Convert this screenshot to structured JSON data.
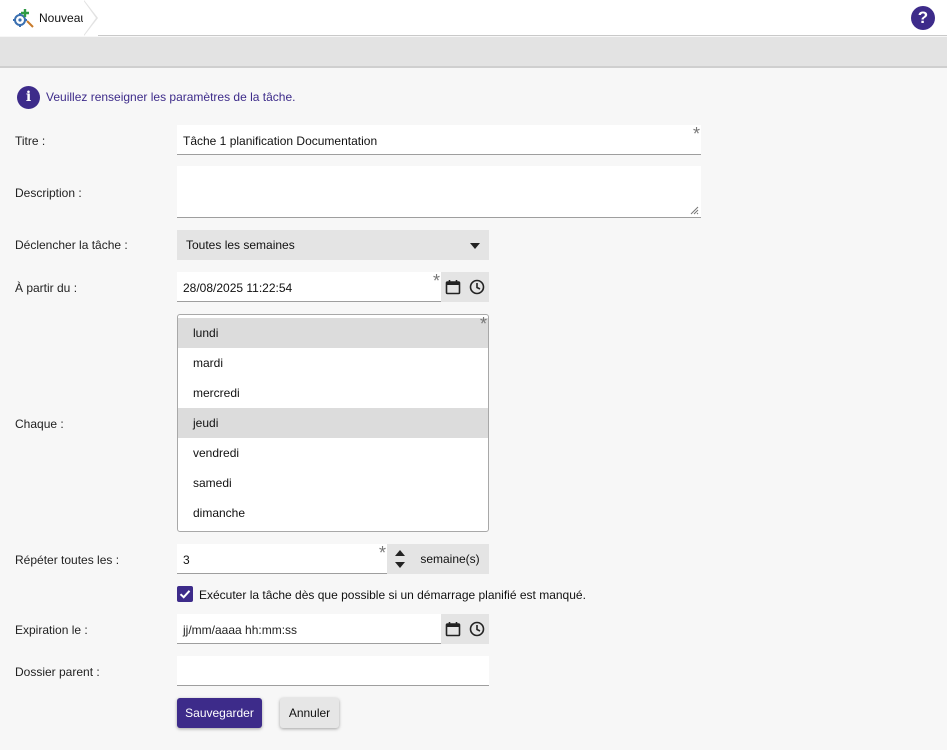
{
  "header": {
    "breadcrumb_label": "Nouveau",
    "breadcrumb_icon": "scheduled-task-icon",
    "help_label": "?",
    "help_icon": "help-circle-icon"
  },
  "info": {
    "icon_label": "i",
    "message": "Veuillez renseigner les paramètres de la tâche."
  },
  "form": {
    "title_label": "Titre :",
    "title_value": "Tâche 1 planification Documentation",
    "description_label": "Description :",
    "description_value": "",
    "trigger_label": "Déclencher la tâche :",
    "trigger_value": "Toutes les semaines",
    "start_label": "À partir du :",
    "start_value": "28/08/2025 11:22:54",
    "every_label": "Chaque :",
    "days": [
      {
        "label": "lundi",
        "selected": true
      },
      {
        "label": "mardi",
        "selected": false
      },
      {
        "label": "mercredi",
        "selected": false
      },
      {
        "label": "jeudi",
        "selected": true
      },
      {
        "label": "vendredi",
        "selected": false
      },
      {
        "label": "samedi",
        "selected": false
      },
      {
        "label": "dimanche",
        "selected": false
      }
    ],
    "repeat_label": "Répéter toutes les :",
    "repeat_value": "3",
    "repeat_unit": "semaine(s)",
    "run_missed_checked": true,
    "run_missed_label": "Exécuter la tâche dès que possible si un démarrage planifié est manqué.",
    "expiration_label": "Expiration le :",
    "expiration_placeholder": "jj/mm/aaaa hh:mm:ss",
    "parent_label": "Dossier parent :",
    "parent_value": "",
    "required_mark": "*"
  },
  "buttons": {
    "save": "Sauvegarder",
    "cancel": "Annuler"
  },
  "colors": {
    "accent": "#3d2b8a",
    "selected_row": "#dcdcdc",
    "control_bg": "#e4e4e4"
  }
}
